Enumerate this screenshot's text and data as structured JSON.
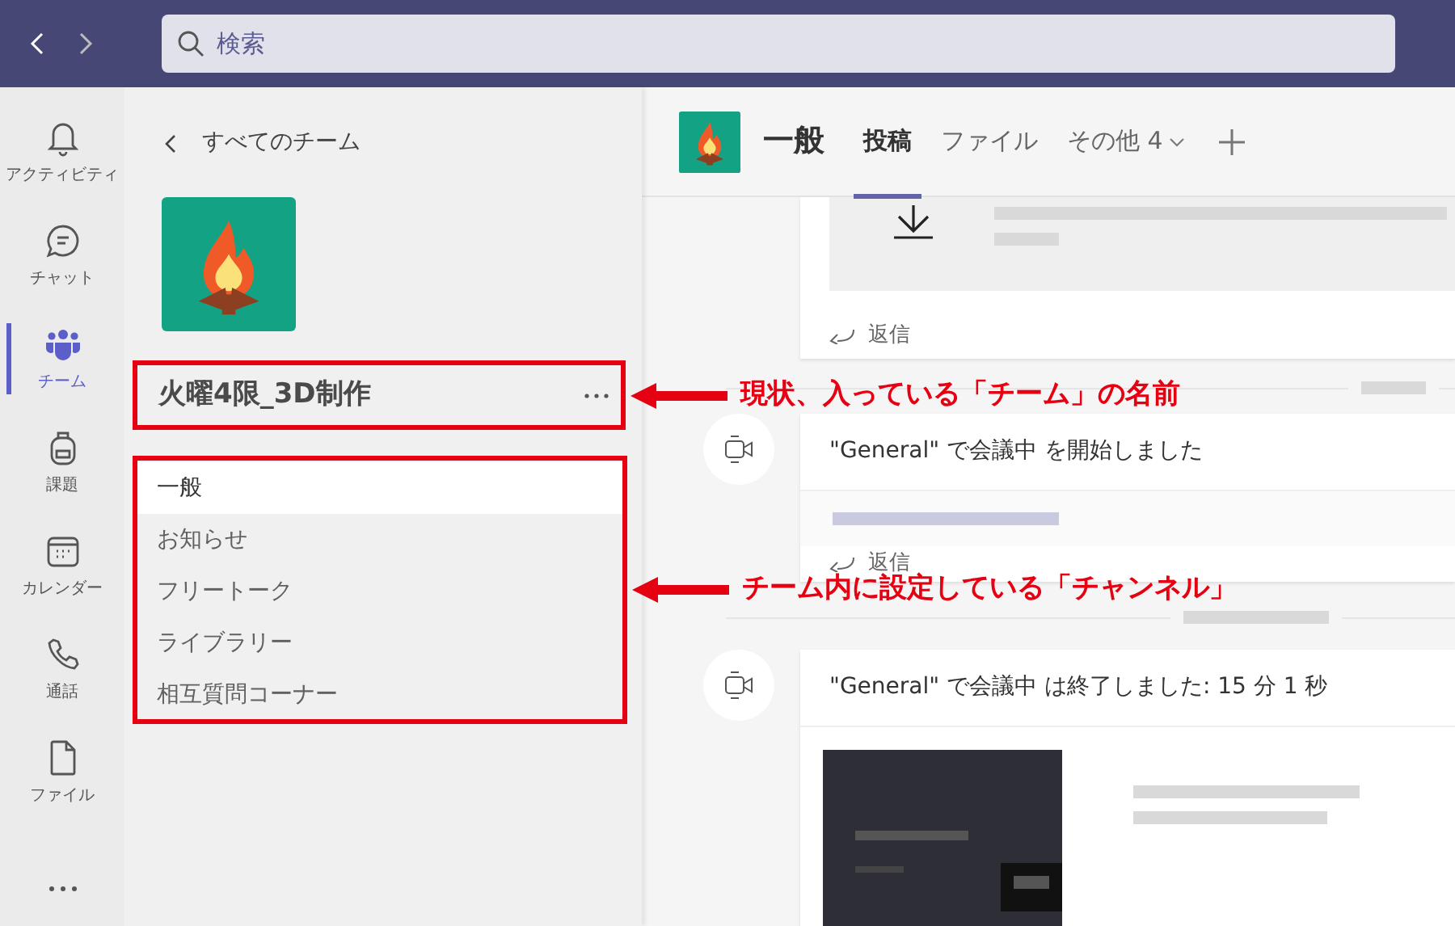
{
  "top_bar": {
    "search": {
      "placeholder": "検索"
    }
  },
  "app_bar": {
    "items": [
      {
        "label": "アクティビティ",
        "selected": false
      },
      {
        "label": "チャット",
        "selected": false
      },
      {
        "label": "チーム",
        "selected": true
      },
      {
        "label": "課題",
        "selected": false
      },
      {
        "label": "カレンダー",
        "selected": false
      },
      {
        "label": "通話",
        "selected": false
      },
      {
        "label": "ファイル",
        "selected": false
      }
    ]
  },
  "team_panel": {
    "back_link": "すべてのチーム",
    "team_name": "火曜4限_3D制作",
    "channels": [
      {
        "label": "一般",
        "selected": true
      },
      {
        "label": "お知らせ",
        "selected": false
      },
      {
        "label": "フリートーク",
        "selected": false
      },
      {
        "label": "ライブラリー",
        "selected": false
      },
      {
        "label": "相互質問コーナー",
        "selected": false
      }
    ]
  },
  "channel_header": {
    "title": "一般",
    "tabs": [
      {
        "label": "投稿",
        "selected": true
      },
      {
        "label": "ファイル",
        "selected": false
      },
      {
        "label": "その他 4",
        "selected": false,
        "dropdown": true
      }
    ]
  },
  "posts": [
    {
      "kind": "file",
      "reply": "返信"
    },
    {
      "kind": "meeting",
      "text": "\"General\" で会議中 を開始しました",
      "reply": "返信"
    },
    {
      "kind": "meeting",
      "text": "\"General\" で会議中 は終了しました: 15 分 1 秒",
      "recording": true
    }
  ],
  "annotations": [
    {
      "text": "現状、入っている「チーム」の名前"
    },
    {
      "text": "チーム内に設定している「チャンネル」"
    }
  ]
}
